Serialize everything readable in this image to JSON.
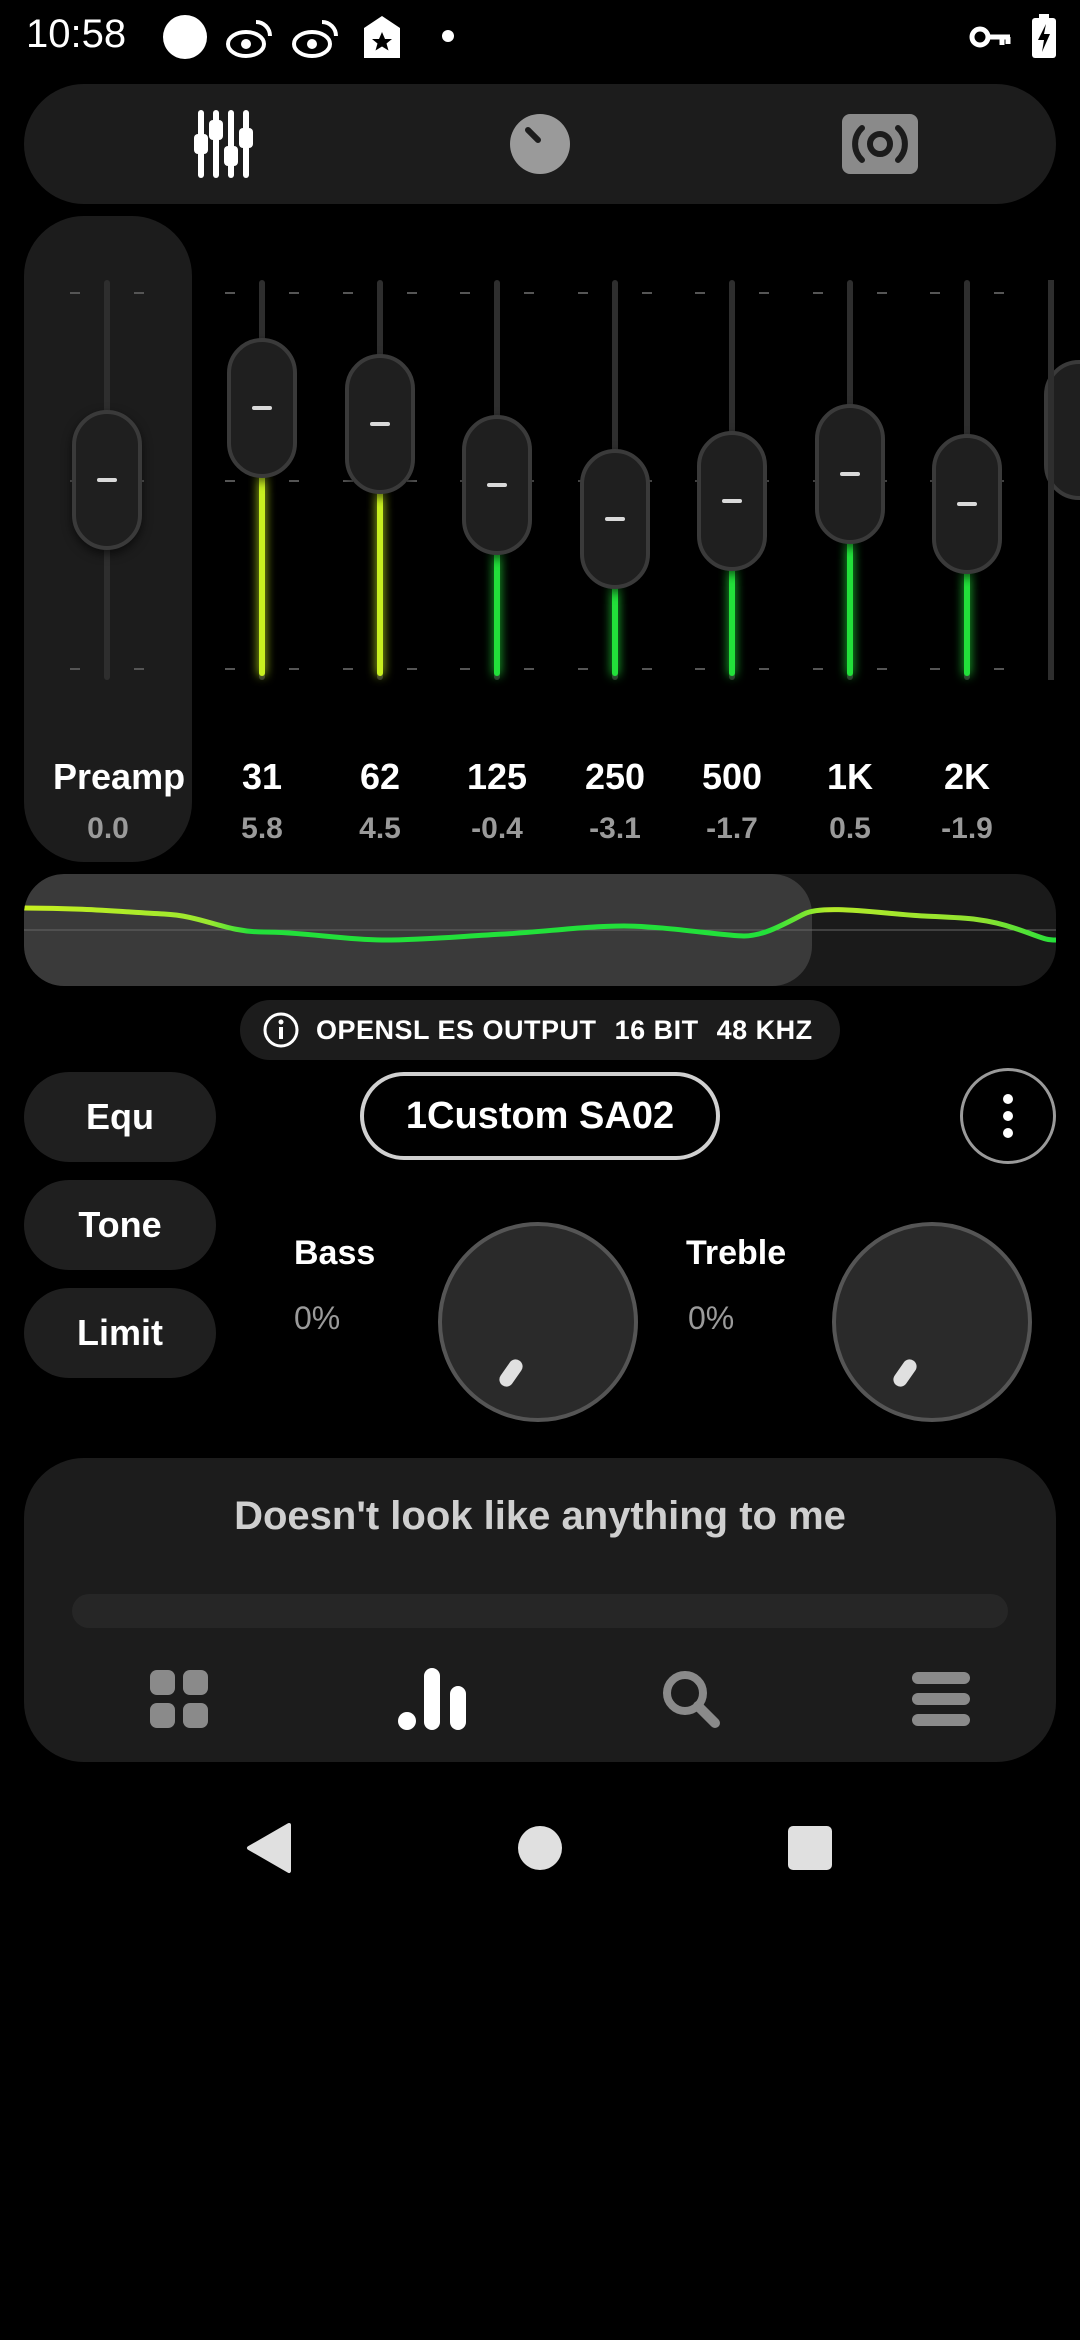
{
  "status_bar": {
    "time": "10:58"
  },
  "colors": {
    "background": "#000000",
    "panel": "#1c1c1c",
    "eq_green": "#22e03a",
    "eq_yellow": "#c8f020",
    "knob": "#1f1f1f"
  },
  "tabs": [
    {
      "icon": "equalizer-sliders-icon"
    },
    {
      "icon": "knob-icon"
    },
    {
      "icon": "surround-speaker-icon"
    }
  ],
  "preamp": {
    "label": "Preamp",
    "value": "0.0",
    "level": 0.0
  },
  "bands": [
    {
      "label": "31",
      "value": "5.8",
      "level": 5.8
    },
    {
      "label": "62",
      "value": "4.5",
      "level": 4.5
    },
    {
      "label": "125",
      "value": "-0.4",
      "level": -0.4
    },
    {
      "label": "250",
      "value": "-3.1",
      "level": -3.1
    },
    {
      "label": "500",
      "value": "-1.7",
      "level": -1.7
    },
    {
      "label": "1K",
      "value": "0.5",
      "level": 0.5
    },
    {
      "label": "2K",
      "value": "-1.9",
      "level": -1.9
    }
  ],
  "output": {
    "api": "OPENSL ES OUTPUT",
    "bits": "16 BIT",
    "rate": "48 KHZ"
  },
  "modes": {
    "equ": "Equ",
    "tone": "Tone",
    "limit": "Limit"
  },
  "preset_name": "1Custom SA02",
  "bass": {
    "label": "Bass",
    "value": "0%"
  },
  "treble": {
    "label": "Treble",
    "value": "0%"
  },
  "player": {
    "song": "Doesn't look like anything to me",
    "progress": 0
  }
}
